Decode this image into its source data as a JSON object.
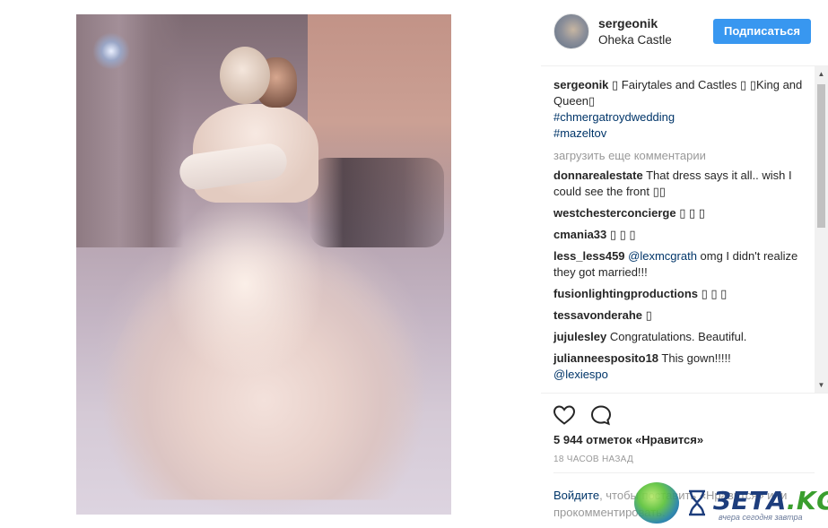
{
  "post": {
    "username": "sergeonik",
    "location": "Oheka Castle",
    "follow_label": "Подписаться"
  },
  "caption": {
    "user": "sergeonik",
    "text": " ▯ Fairytales and Castles ▯ ▯King and Queen▯",
    "hashtags": [
      "#chmergatroydwedding",
      "#mazeltov"
    ]
  },
  "load_more_label": "загрузить еще комментарии",
  "comments": [
    {
      "user": "donnarealestate",
      "text": " That dress says it all.. wish I could see the front ▯▯",
      "mention": ""
    },
    {
      "user": "westchesterconcierge",
      "text": " ▯ ▯ ▯",
      "mention": ""
    },
    {
      "user": "cmania33",
      "text": " ▯ ▯ ▯",
      "mention": ""
    },
    {
      "user": "less_less459",
      "mention": " @lexmcgrath",
      "text": " omg I didn't realize they got married!!!"
    },
    {
      "user": "fusionlightingproductions",
      "text": " ▯ ▯ ▯",
      "mention": ""
    },
    {
      "user": "tessavonderahe",
      "text": " ▯",
      "mention": ""
    },
    {
      "user": "jujulesley",
      "text": " Congratulations. Beautiful.",
      "mention": ""
    },
    {
      "user": "julianneesposito18",
      "text": " This gown!!!!!",
      "mention": "@lexiespo"
    }
  ],
  "actions": {
    "likes": "5 944 отметок «Нравится»",
    "time": "18 ЧАСОВ НАЗАД",
    "login_link": "Войдите",
    "login_text": ", чтобы поставить «Нравится» или прокомментировать."
  },
  "watermark": {
    "brand": "ЗЕТА",
    "domain": ".KG",
    "tagline": "вчера сегодня завтра"
  },
  "icons": [
    "heart-icon",
    "comment-icon",
    "scroll-up-icon",
    "scroll-down-icon"
  ],
  "colors": {
    "accent": "#3897f0",
    "link": "#003569",
    "muted": "#999999"
  }
}
